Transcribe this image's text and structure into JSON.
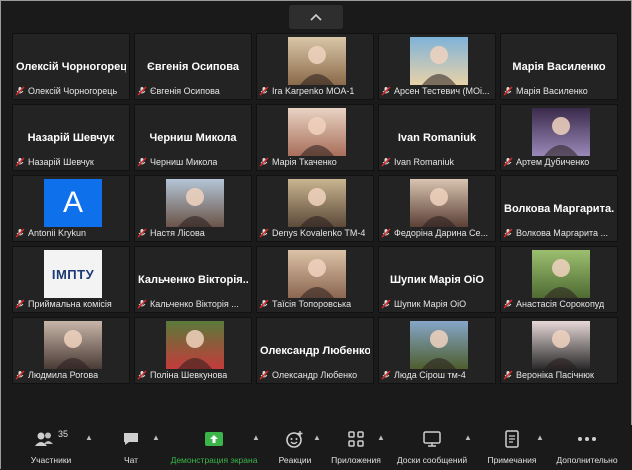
{
  "participants_count": "35",
  "tiles": [
    {
      "name_big": "Олексій Чорногорець",
      "label": "Олексій Чорногорець"
    },
    {
      "name_big": "Євгенія Осипова",
      "label": "Євгенія Осипова"
    },
    {
      "photo": "photo-1",
      "label": "Ira Karpenko МОА-1"
    },
    {
      "photo": "photo-2",
      "label": "Арсен Тестевич (МОі..."
    },
    {
      "name_big": "Марія Василенко",
      "label": "Марія Василенко"
    },
    {
      "name_big": "Назарій Шевчук",
      "label": "Назарій Шевчук"
    },
    {
      "name_big": "Черниш Микола",
      "label": "Черниш Микола"
    },
    {
      "photo": "photo-3",
      "label": "Марія Ткаченко"
    },
    {
      "name_big": "Ivan Romaniuk",
      "label": "Ivan Romaniuk"
    },
    {
      "photo": "photo-4",
      "label": "Артем Дубиченко"
    },
    {
      "avatar": "A",
      "label": "Antonii Krykun"
    },
    {
      "photo": "photo-5",
      "label": "Настя Лісова"
    },
    {
      "photo": "photo-6",
      "label": "Denys Kovalenko TM-4"
    },
    {
      "photo": "photo-7",
      "label": "Федоріна Дарина Се..."
    },
    {
      "name_big": "Волкова Маргарита...",
      "label": "Волкова Маргарита ..."
    },
    {
      "logo": "ІМПТУ",
      "label": "Приймальна комісія"
    },
    {
      "name_big": "Кальченко Вікторія...",
      "label": "Кальченко Вікторія ..."
    },
    {
      "photo": "photo-8",
      "label": "Таїсія Топоровська"
    },
    {
      "name_big": "Шупик Марія ОіО",
      "label": "Шупик Марія ОіО"
    },
    {
      "photo": "photo-9",
      "label": "Анастасія Сорокопуд"
    },
    {
      "photo": "photo-10",
      "label": "Людмила Рогова"
    },
    {
      "photo": "photo-11",
      "label": "Поліна Шевкунова"
    },
    {
      "name_big": "Олександр Любенко",
      "label": "Олександр Любенко"
    },
    {
      "photo": "photo-12",
      "label": "Люда Сірош тм-4"
    },
    {
      "photo": "photo-13",
      "label": "Вероніка Пасічнюк"
    }
  ],
  "toolbar": {
    "participants": "Участники",
    "chat": "Чат",
    "share": "Демонстрация экрана",
    "reactions": "Реакции",
    "apps": "Приложения",
    "whiteboards": "Доски сообщений",
    "notes": "Примечания",
    "more": "Дополнительно"
  },
  "colors": {
    "accent_green": "#3bb54a",
    "avatar_blue": "#0e71eb",
    "mute_red": "#e02828"
  }
}
